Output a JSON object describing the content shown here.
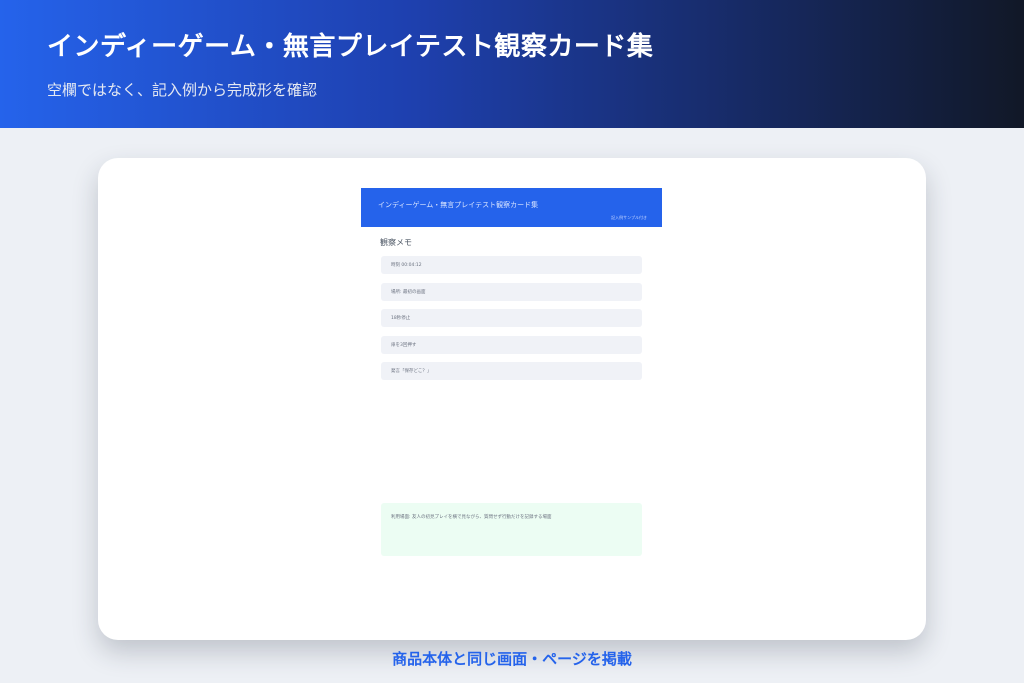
{
  "hero": {
    "title": "インディーゲーム・無言プレイテスト観察カード集",
    "subtitle": "空欄ではなく、記入例から完成形を確認"
  },
  "preview": {
    "header_title": "インディーゲーム・無言プレイテスト観察カード集",
    "header_note": "記入例サンプル付き",
    "section_label": "観察メモ",
    "fields": [
      "時刻 00:04:12",
      "場所: 最初の画面",
      "18秒停止",
      "扉を3回押す",
      "発言「保存どこ？」"
    ],
    "summary": "利用場面: 友人の初見プレイを横で見ながら、質問せず行動だけを記録する場面"
  },
  "caption": "商品本体と同じ画面・ページを掲載",
  "colors": {
    "brand": "#2563eb",
    "hero_end": "#111827",
    "caption": "#2563eb",
    "summary_bg": "#ecfdf3",
    "field_bg": "#f0f2f7"
  }
}
